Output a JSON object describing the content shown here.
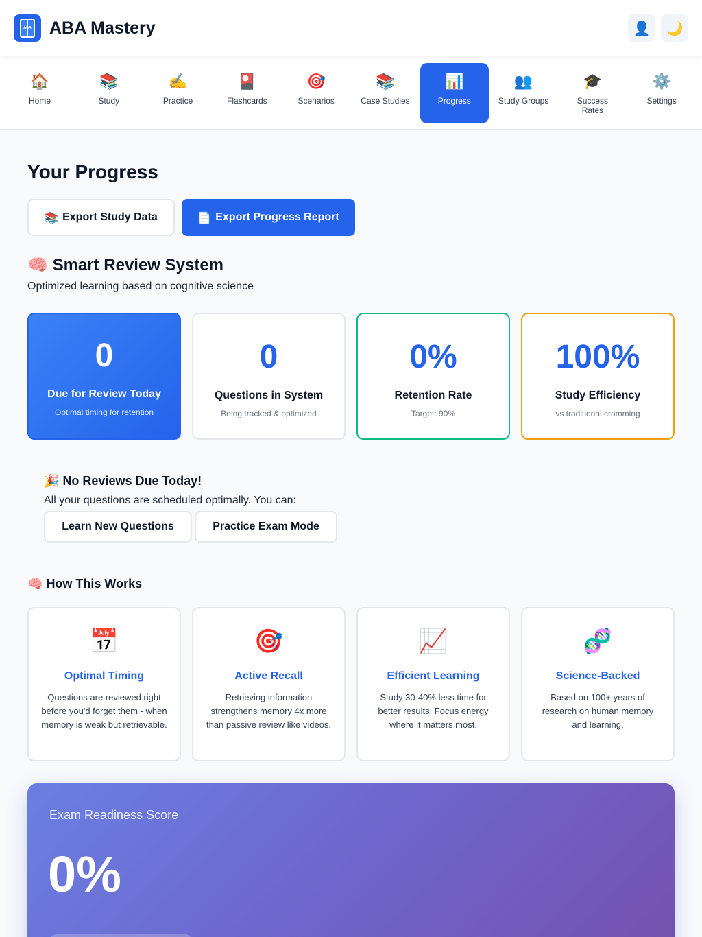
{
  "header": {
    "app_title": "ABA Mastery",
    "logo_text": "ABA",
    "logo_icon": "book-icon",
    "profile_icon": "👤",
    "theme_icon": "🌙"
  },
  "nav": {
    "items": [
      {
        "label": "Home",
        "icon": "🏠",
        "icon_name": "home-icon",
        "active": false
      },
      {
        "label": "Study",
        "icon": "📚",
        "icon_name": "books-icon",
        "active": false
      },
      {
        "label": "Practice",
        "icon": "✍️",
        "icon_name": "writing-hand-icon",
        "active": false
      },
      {
        "label": "Flashcards",
        "icon": "🎴",
        "icon_name": "flashcard-icon",
        "active": false
      },
      {
        "label": "Scenarios",
        "icon": "🎯",
        "icon_name": "target-icon",
        "active": false
      },
      {
        "label": "Case Studies",
        "icon": "📚",
        "icon_name": "books-icon",
        "active": false
      },
      {
        "label": "Progress",
        "icon": "📊",
        "icon_name": "bar-chart-icon",
        "active": true
      },
      {
        "label": "Study Groups",
        "icon": "👥",
        "icon_name": "group-icon",
        "active": false
      },
      {
        "label": "Success Rates",
        "icon": "🎓",
        "icon_name": "graduation-cap-icon",
        "active": false
      },
      {
        "label": "Settings",
        "icon": "⚙️",
        "icon_name": "gear-icon",
        "active": false
      }
    ]
  },
  "page": {
    "title": "Your Progress",
    "export_study_data": "Export Study Data",
    "export_study_data_icon": "📚",
    "export_progress_report": "Export Progress Report",
    "export_progress_report_icon": "📄"
  },
  "smart_review": {
    "icon": "🧠",
    "title": "Smart Review System",
    "subtitle": "Optimized learning based on cognitive science",
    "stats": [
      {
        "value": "0",
        "label": "Due for Review Today",
        "sub": "Optimal timing for retention"
      },
      {
        "value": "0",
        "label": "Questions in System",
        "sub": "Being tracked & optimized"
      },
      {
        "value": "0%",
        "label": "Retention Rate",
        "sub": "Target: 90%"
      },
      {
        "value": "100%",
        "label": "Study Efficiency",
        "sub": "vs traditional cramming"
      }
    ]
  },
  "no_reviews": {
    "icon": "🎉",
    "title": "No Reviews Due Today!",
    "text": "All your questions are scheduled optimally. You can:",
    "learn_button": "Learn New Questions",
    "exam_button": "Practice Exam Mode"
  },
  "how_it_works": {
    "icon": "🧠",
    "title": "How This Works",
    "cards": [
      {
        "icon": "📅",
        "icon_name": "calendar-icon",
        "title": "Optimal Timing",
        "text": "Questions are reviewed right before you'd forget them - when memory is weak but retrievable."
      },
      {
        "icon": "🎯",
        "icon_name": "target-icon",
        "title": "Active Recall",
        "text": "Retrieving information strengthens memory 4x more than passive review like videos."
      },
      {
        "icon": "📈",
        "icon_name": "chart-increasing-icon",
        "title": "Efficient Learning",
        "text": "Study 30-40% less time for better results. Focus energy where it matters most."
      },
      {
        "icon": "🧬",
        "icon_name": "dna-icon",
        "title": "Science-Backed",
        "text": "Based on 100+ years of research on human memory and learning."
      }
    ]
  },
  "readiness": {
    "title": "Exam Readiness Score",
    "value": "0%",
    "fraction": 0
  },
  "colors": {
    "accent": "#2563eb",
    "green_border": "#10b981",
    "orange_border": "#f59e0b",
    "readiness_gradient_start": "#6a7fe3",
    "readiness_gradient_end": "#7551ad"
  }
}
